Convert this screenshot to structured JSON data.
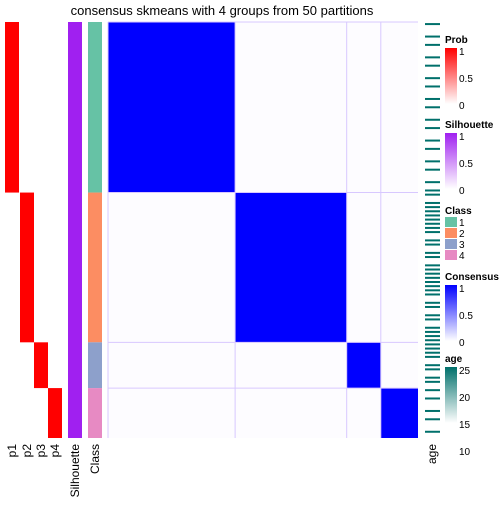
{
  "chart_data": {
    "type": "heatmap",
    "title": "consensus skmeans with 4 groups from 50 partitions",
    "class_sizes": [
      41,
      36,
      11,
      12
    ],
    "annotation_columns": [
      "p1",
      "p2",
      "p3",
      "p4",
      "Silhouette",
      "Class"
    ],
    "right_annotation": "age",
    "class_colors": [
      "#66C2A5",
      "#FC8D62",
      "#8DA0CB",
      "#E78AC3"
    ],
    "consensus_color": "#0000FF",
    "prob_color": "#FF0000",
    "silhouette_color": "#A020F0",
    "age_color": "#00706B",
    "legends": {
      "prob": {
        "title": "Prob",
        "ticks": [
          "1",
          "0.5",
          "0"
        ]
      },
      "silhouette": {
        "title": "Silhouette",
        "ticks": [
          "1",
          "0.5",
          "0"
        ]
      },
      "class": {
        "title": "Class",
        "labels": [
          "1",
          "2",
          "3",
          "4"
        ]
      },
      "consensus": {
        "title": "Consensus",
        "ticks": [
          "1",
          "0.5",
          "0"
        ]
      },
      "age": {
        "title": "age",
        "ticks": [
          "25",
          "20",
          "15",
          "10"
        ]
      }
    }
  }
}
